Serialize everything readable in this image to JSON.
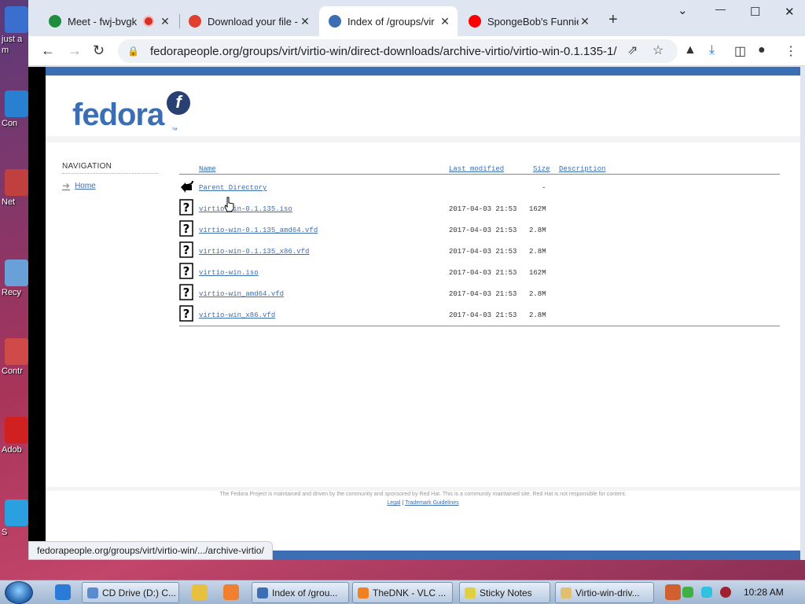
{
  "desktop": {
    "icons": [
      {
        "label": "just a",
        "sub": "m",
        "color": "#3a6fcf"
      },
      {
        "label": "Con",
        "color": "#2a80d0"
      },
      {
        "label": "Net",
        "color": "#c04040"
      },
      {
        "label": "Recy",
        "color": "#6aa0d8"
      },
      {
        "label": "Contr",
        "color": "#d04a4a"
      },
      {
        "label": "Adob",
        "color": "#d02020"
      },
      {
        "label": "S",
        "color": "#2aa0e0"
      }
    ]
  },
  "browser": {
    "tabs": [
      {
        "title": "Meet - fwj-bvgk",
        "favicon": "google-meet-icon",
        "color": "#1e8e3e",
        "recording": true
      },
      {
        "title": "Download your file -",
        "favicon": "download-site-icon",
        "color": "#e04030"
      },
      {
        "title": "Index of /groups/vir",
        "favicon": "fedora-icon",
        "color": "#3c6eb4",
        "active": true
      },
      {
        "title": "SpongeBob's Funnie",
        "favicon": "youtube-icon",
        "color": "#ff0000"
      }
    ],
    "close_glyph": "✕",
    "new_tab_glyph": "+",
    "window_controls": {
      "dropdown": "⌄",
      "minimize": "—",
      "maximize": "☐",
      "close": "✕"
    },
    "url": "fedorapeople.org/groups/virt/virtio-win/direct-downloads/archive-virtio/virtio-win-0.1.135-1/",
    "status_url": "fedorapeople.org/groups/virt/virtio-win/.../archive-virtio/"
  },
  "page": {
    "logo_text": "fedora",
    "logo_mark": "f",
    "logo_tm": "™",
    "navigation": {
      "heading": "NAVIGATION",
      "home": "Home"
    },
    "columns": {
      "name": "Name",
      "modified": "Last modified",
      "size": "Size",
      "description": "Description"
    },
    "parent": {
      "name": "Parent Directory",
      "size": "-"
    },
    "files": [
      {
        "name": "virtio-win-0.1.135.iso",
        "modified": "2017-04-03 21:53",
        "size": "162M"
      },
      {
        "name": "virtio-win-0.1.135_amd64.vfd",
        "modified": "2017-04-03 21:53",
        "size": "2.8M"
      },
      {
        "name": "virtio-win-0.1.135_x86.vfd",
        "modified": "2017-04-03 21:53",
        "size": "2.8M"
      },
      {
        "name": "virtio-win.iso",
        "modified": "2017-04-03 21:53",
        "size": "162M"
      },
      {
        "name": "virtio-win_amd64.vfd",
        "modified": "2017-04-03 21:53",
        "size": "2.8M"
      },
      {
        "name": "virtio-win_x86.vfd",
        "modified": "2017-04-03 21:53",
        "size": "2.8M"
      }
    ],
    "footer": {
      "text": "The Fedora Project is maintained and driven by the community and sponsored by Red Hat. This is a community maintained site. Red Hat is not responsible for content.",
      "legal": "Legal",
      "separator": "|",
      "trademark": "Trademark Guidelines"
    }
  },
  "taskbar": {
    "items": [
      {
        "label": "CD Drive (D:) C...",
        "color": "#5a8ad0"
      },
      {
        "label": "Index of /grou...",
        "color": "#3c6eb4"
      },
      {
        "label": "TheDNK - VLC ...",
        "color": "#f08020"
      },
      {
        "label": "Sticky Notes",
        "color": "#e0d040"
      },
      {
        "label": "Virtio-win-driv...",
        "color": "#e0c070"
      }
    ],
    "clock": "10:28 AM"
  }
}
